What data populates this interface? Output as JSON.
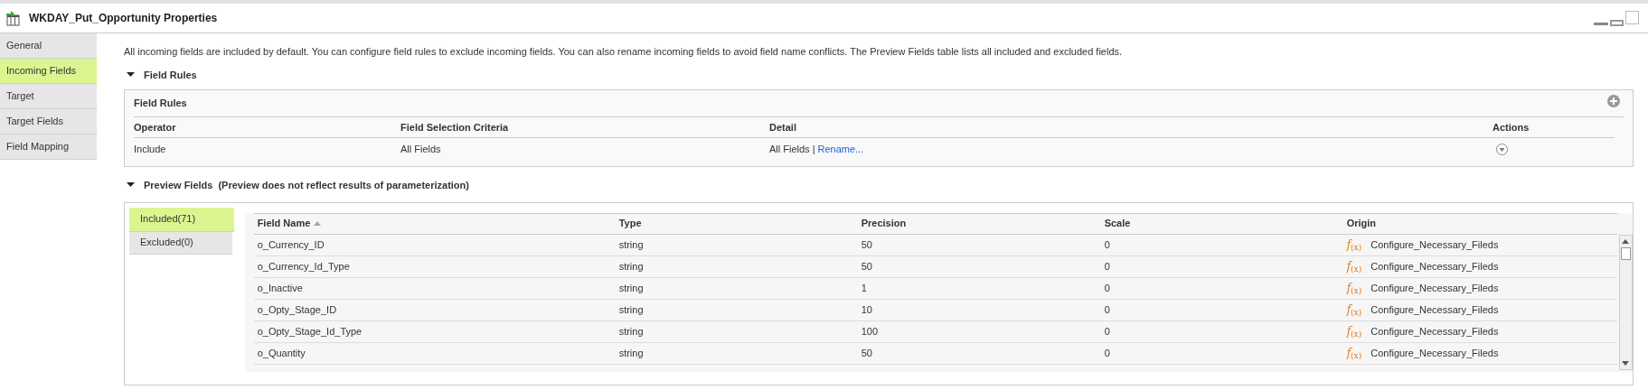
{
  "window": {
    "title": "WKDAY_Put_Opportunity Properties"
  },
  "sidebar": {
    "items": [
      {
        "label": "General",
        "selected": false
      },
      {
        "label": "Incoming Fields",
        "selected": true
      },
      {
        "label": "Target",
        "selected": false
      },
      {
        "label": "Target Fields",
        "selected": false
      },
      {
        "label": "Field Mapping",
        "selected": false
      }
    ]
  },
  "description": "All incoming fields are included by default. You can configure field rules to exclude incoming fields. You can also rename incoming fields to avoid field name conflicts. The Preview Fields table lists all included and excluded fields.",
  "field_rules": {
    "heading": "Field Rules",
    "expanded": true,
    "panel_title": "Field Rules",
    "columns": [
      "Operator",
      "Field Selection Criteria",
      "Detail",
      "Actions"
    ],
    "rows": [
      {
        "operator": "Include",
        "criteria": "All Fields",
        "detail": "All Fields",
        "separator": "|",
        "link": "Rename..."
      }
    ]
  },
  "preview_fields": {
    "heading": "Preview Fields",
    "note": "(Preview does not reflect results of parameterization)",
    "expanded": true,
    "tabs": [
      {
        "label": "Included(71)",
        "selected": true
      },
      {
        "label": "Excluded(0)",
        "selected": false
      }
    ],
    "columns": [
      "Field Name",
      "Type",
      "Precision",
      "Scale",
      "Origin"
    ],
    "rows": [
      {
        "name": "o_Currency_ID",
        "type": "string",
        "precision": "50",
        "scale": "0",
        "origin_icon": "*f*$_{(x)}$",
        "origin": "Configure_Necessary_Fileds"
      },
      {
        "name": "o_Currency_Id_Type",
        "type": "string",
        "precision": "50",
        "scale": "0",
        "origin_icon": "*f*$_{(x)}$",
        "origin": "Configure_Necessary_Fileds"
      },
      {
        "name": "o_Inactive",
        "type": "string",
        "precision": "1",
        "scale": "0",
        "origin_icon": "*f*$_{(x)}$",
        "origin": "Configure_Necessary_Fileds"
      },
      {
        "name": "o_Opty_Stage_ID",
        "type": "string",
        "precision": "10",
        "scale": "0",
        "origin_icon": "*f*$_{(x)}$",
        "origin": "Configure_Necessary_Fileds"
      },
      {
        "name": "o_Opty_Stage_Id_Type",
        "type": "string",
        "precision": "100",
        "scale": "0",
        "origin_icon": "*f*$_{(x)}$",
        "origin": "Configure_Necessary_Fileds"
      },
      {
        "name": "o_Quantity",
        "type": "string",
        "precision": "50",
        "scale": "0",
        "origin_icon": "*f*$_{(x)}$",
        "origin": "Configure_Necessary_Fileds"
      }
    ]
  }
}
